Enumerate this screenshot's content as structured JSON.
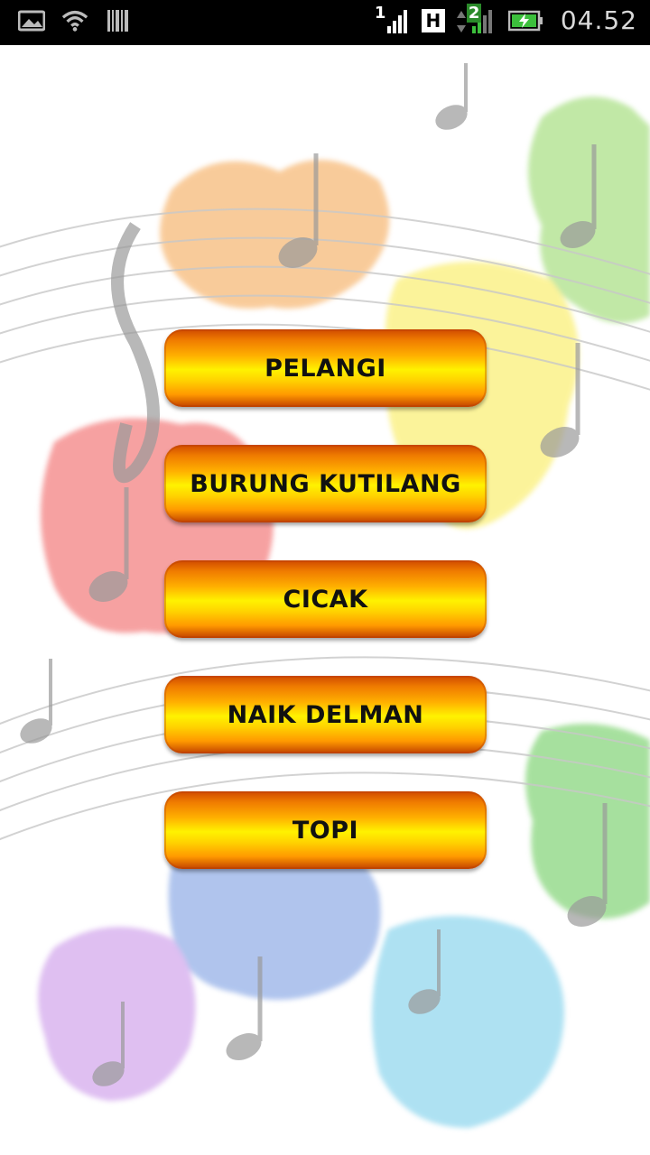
{
  "status_bar": {
    "time": "04.52",
    "sim1_label": "1",
    "network_type": "H",
    "sim2_label": "2",
    "icons": [
      "image-icon",
      "wifi-icon",
      "barcode-icon",
      "signal-icon",
      "signal-icon",
      "battery-charging-icon"
    ]
  },
  "songs": [
    {
      "label": "PELANGI"
    },
    {
      "label": "BURUNG KUTILANG"
    },
    {
      "label": "CICAK"
    },
    {
      "label": "NAIK DELMAN"
    },
    {
      "label": "TOPI"
    }
  ],
  "colors": {
    "button_top": "#d04a00",
    "button_mid": "#fff200",
    "button_bottom": "#c24200",
    "status_bar": "#000000"
  }
}
